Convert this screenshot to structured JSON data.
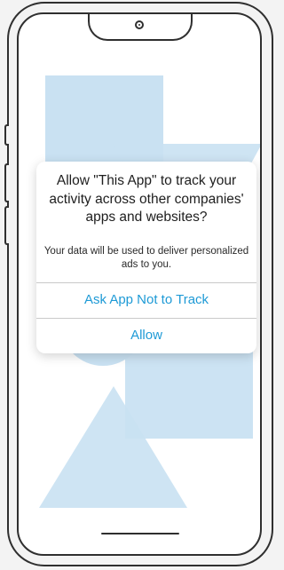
{
  "dialog": {
    "title": "Allow \"This App\" to track your activity across other companies' apps and websites?",
    "message": "Your data will be used to deliver personalized ads to you.",
    "deny_label": "Ask App Not to Track",
    "allow_label": "Allow"
  },
  "colors": {
    "accent": "#1e9ad6",
    "decoration": "#c9e1f2"
  }
}
